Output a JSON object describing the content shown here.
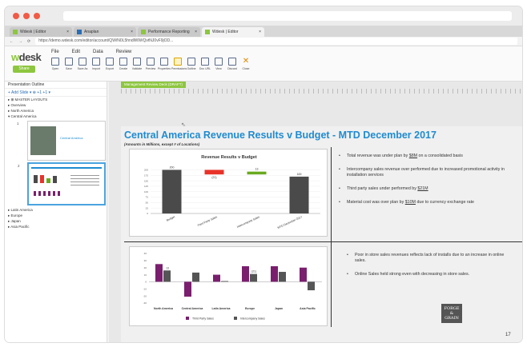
{
  "browser": {
    "tabs": [
      {
        "label": "Wdesk | Editor"
      },
      {
        "label": "Anaplan"
      },
      {
        "label": "Performance Reporting"
      },
      {
        "label": "Wdesk | Editor"
      }
    ],
    "url": "https://demo.wdesk.com/editor/account/QW/N0L5hndlWW/QvtNJ0vF9jOD..."
  },
  "app": {
    "logo_w": "w",
    "logo_rest": "desk",
    "menu": [
      "File",
      "Edit",
      "Data",
      "Review"
    ],
    "share_label": "Share",
    "toolbar": [
      "Open",
      "Save",
      "Save As",
      "Import",
      "Export",
      "Create",
      "Validate",
      "Preview",
      "Properties",
      "Permissions",
      "Outline",
      "Doc URL",
      "View",
      "Discard",
      "Close"
    ]
  },
  "sidebar": {
    "title": "Presentation Outline",
    "tools": "+ Add Slide ▾  ⊕  +1  +1  ▾",
    "sections_top": [
      "▸ ⊞ MASTER LAYOUTS",
      "▸ Overview",
      "▸ North America",
      "▾ Central America"
    ],
    "thumb1_num": "1",
    "thumb1_title": "Central America",
    "thumb2_num": "2",
    "sections_bottom": [
      "▸ Latin America",
      "▸ Europe",
      "▸ Japan",
      "▸ Asia Pacific"
    ]
  },
  "editor": {
    "tab_label": "Management Review Deck (DRAFT)",
    "slide_title": "Central America Revenue Results v Budget - MTD December 2017",
    "slide_subtitle": "(Amounts in Millions, except # of Locations)",
    "bullets_top": [
      {
        "pre": "Total revenue was under plan by ",
        "u": "$8M",
        "post": " on a consolidated basis"
      },
      {
        "pre": "Intercompany sales revenue over performed due to increased promotional activity in installation services",
        "u": "",
        "post": ""
      },
      {
        "pre": "Third party sales under performed by ",
        "u": "$21M",
        "post": ""
      },
      {
        "pre": "Material cost was over plan by ",
        "u": "$10M",
        "post": " due to currency exchange rate"
      }
    ],
    "bullets_bottom": [
      {
        "pre": "Poor in store sales revenues reflects lack of installs due to an increase in online sales.",
        "u": "",
        "post": ""
      },
      {
        "pre": "Online Sales held strong even with decreasing in store sales.",
        "u": "",
        "post": ""
      }
    ],
    "forge_line1": "FORGE",
    "forge_line2": "&",
    "forge_line3": "GRAIN",
    "page_number": "17"
  },
  "chart_data": [
    {
      "type": "bar",
      "title": "Revenue Results v Budget",
      "categories": [
        "Budget",
        "Third Party Sales",
        "Intercompany Sales",
        "MTD December 2017"
      ],
      "values": [
        200,
        -21,
        13,
        169
      ],
      "data_labels": [
        "200",
        "(21)",
        "13",
        "169"
      ],
      "colors": [
        "#4a4a4a",
        "#e8332a",
        "#6aaa1e",
        "#4a4a4a"
      ],
      "ylim": [
        0,
        220
      ]
    },
    {
      "type": "bar",
      "categories": [
        "North America",
        "Central America",
        "Latin America",
        "Europe",
        "Japan",
        "Asia Pacific"
      ],
      "series": [
        {
          "name": "Third Party Sales",
          "values": [
            25,
            -21,
            10,
            22,
            22,
            20
          ],
          "color": "#7a1f6e"
        },
        {
          "name": "Intercompany Sales",
          "values": [
            16,
            13,
            1,
            11,
            14,
            -12
          ],
          "color": "#555555"
        }
      ],
      "data_labels": {
        "1": "13",
        "7": "(21)"
      },
      "yticks": [
        -30,
        -20,
        -10,
        0,
        10,
        20,
        30,
        40
      ],
      "ylim": [
        -30,
        40
      ],
      "legend": "bottom"
    }
  ]
}
